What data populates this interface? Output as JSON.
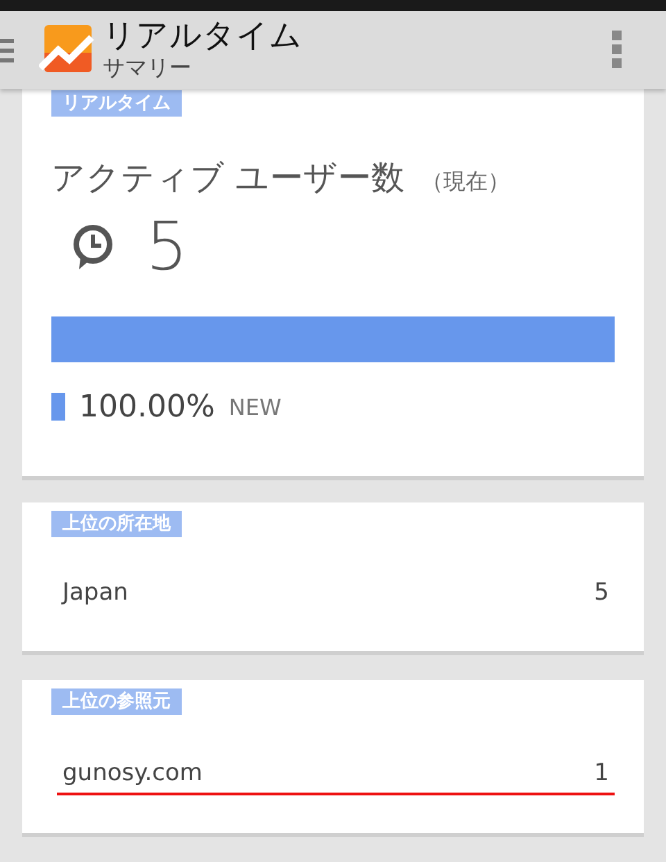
{
  "app_bar": {
    "title": "リアルタイム",
    "subtitle": "サマリー"
  },
  "active_users": {
    "label": "リアルタイム",
    "heading": "アクティブ ユーザー数",
    "qualifier": "（現在）",
    "count": "5",
    "bar": {
      "level": 1.0
    },
    "legend": {
      "value": "100.00%",
      "name": "NEW"
    }
  },
  "lists": [
    {
      "label": "上位の所在地",
      "rows": [
        {
          "name": "Japan",
          "value": "5",
          "underlined": false
        }
      ]
    },
    {
      "label": "上位の参照元",
      "rows": [
        {
          "name": "gunosy.com",
          "value": "1",
          "underlined": true
        }
      ]
    }
  ]
}
